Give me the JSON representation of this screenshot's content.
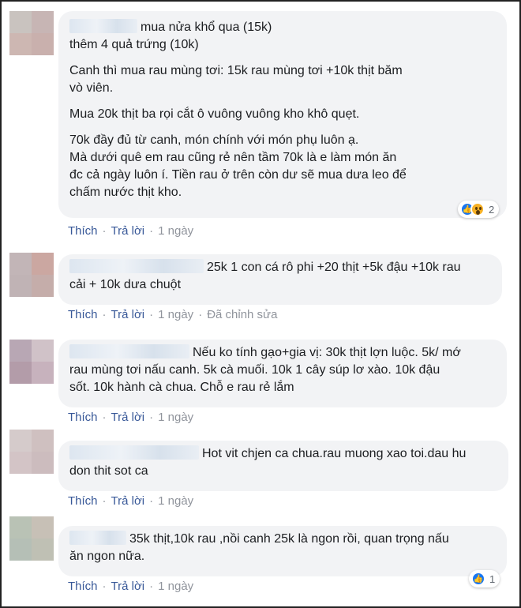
{
  "comments": [
    {
      "lines_first": "mua nửa khổ qua (15k)",
      "paragraphs": [
        "thêm 4 quả trứng (10k)",
        "Canh thì mua rau mùng tơi: 15k rau mùng tơi +10k thịt băm\nvò viên.",
        "Mua 20k thịt ba rọi cắt ô vuông vuông kho khô quẹt.",
        "70k đầy đủ từ canh, món chính với món phụ luôn ạ.\nMà dưới quê em rau cũng rẻ nên tầm 70k là e làm món ăn\nđc cả ngày luôn í. Tiền rau ở trên còn dư sẽ mua dưa leo để\nchấm nước thịt kho."
      ],
      "like": "Thích",
      "reply": "Trả lời",
      "time": "1 ngày",
      "reactions": {
        "icons": [
          "like-icon",
          "wow-icon"
        ],
        "count": "2"
      },
      "avatar_colors": [
        "#c9c3bf",
        "#c7b5b4",
        "#cdb7b2",
        "#c9b0ad"
      ]
    },
    {
      "lines_first": "25k 1 con cá rô phi +20 thịt +5k đậu +10k rau\ncải + 10k dưa chuột",
      "like": "Thích",
      "reply": "Trả lời",
      "time": "1 ngày",
      "edited": "Đã chỉnh sửa",
      "avatar_colors": [
        "#c2b5b7",
        "#cba7a1",
        "#c0b3b5",
        "#c5adaa"
      ]
    },
    {
      "lines_first": "Nếu ko tính gạo+gia vị: 30k thịt lợn luộc. 5k/ mớ\nrau mùng tơi nấu canh. 5k cà muối. 10k 1 cây súp lơ xào. 10k đậu\nsốt. 10k hành cà chua. Chỗ e rau rẻ lắm",
      "like": "Thích",
      "reply": "Trả lời",
      "time": "1 ngày",
      "avatar_colors": [
        "#b8a7b4",
        "#d0c2c8",
        "#b39ca9",
        "#c7b2bd"
      ]
    },
    {
      "lines_first": "Hot vit chjen ca chua.rau muong xao toi.dau hu\ndon thit sot ca",
      "like": "Thích",
      "reply": "Trả lời",
      "time": "1 ngày",
      "avatar_colors": [
        "#d5cbcb",
        "#cfc0c0",
        "#d3c4c6",
        "#ccbcbe"
      ]
    },
    {
      "lines_first": "35k thịt,10k rau ,nồi canh 25k là ngon rồi, quan trọng nấu\năn ngon nữa.",
      "like": "Thích",
      "reply": "Trả lời",
      "time": "1 ngày",
      "reactions": {
        "icons": [
          "like-icon"
        ],
        "count": "1"
      },
      "avatar_colors": [
        "#b9c2b5",
        "#c7c0b6",
        "#b5bfb6",
        "#bfc0b4"
      ]
    }
  ]
}
